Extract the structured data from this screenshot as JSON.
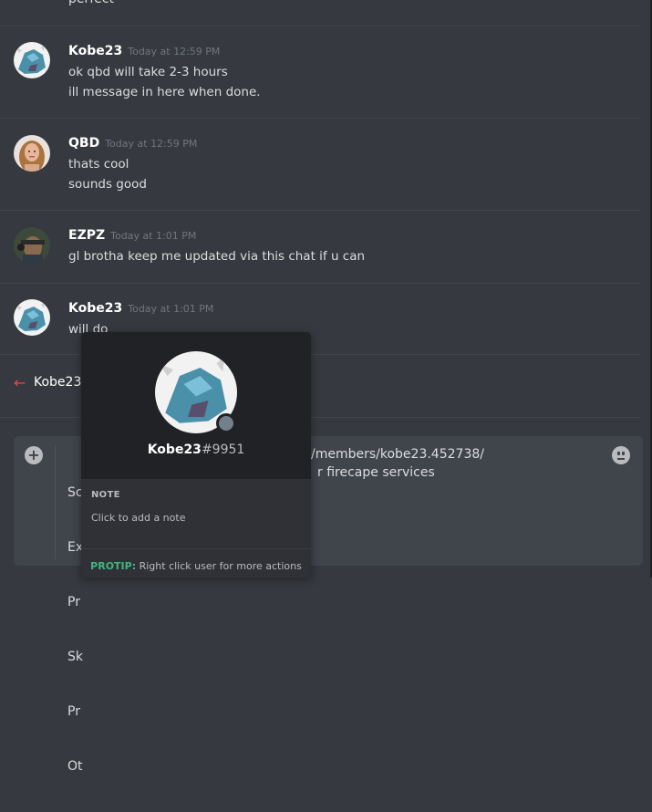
{
  "chat": {
    "top_fragment": "perfect",
    "messages": [
      {
        "author": "Kobe23",
        "timestamp": "Today at 12:59 PM",
        "lines": [
          "ok qbd will take 2-3 hours",
          "ill message in here when done."
        ]
      },
      {
        "author": "QBD",
        "timestamp": "Today at 12:59 PM",
        "lines": [
          "thats cool",
          "sounds good"
        ]
      },
      {
        "author": "EZPZ",
        "timestamp": "Today at 1:01 PM",
        "lines": [
          "gl brotha keep me updated via this chat if u can"
        ]
      },
      {
        "author": "Kobe23",
        "timestamp": "Today at 1:01 PM",
        "lines": [
          "will do"
        ]
      }
    ],
    "system_message": {
      "icon": "arrow-left-icon",
      "text": "Kobe23"
    }
  },
  "input": {
    "lines": [
      "Sc",
      "Ex",
      "Pr",
      "Sk",
      "Pr",
      "Ot"
    ],
    "partial_line_1": "/members/kobe23.452738/",
    "partial_line_2": "r firecape services"
  },
  "popout": {
    "username": "Kobe23",
    "discriminator": "#9951",
    "note_label": "NOTE",
    "note_placeholder": "Click to add a note",
    "protip_label": "PROTIP:",
    "protip_text": "Right click user for more actions"
  },
  "colors": {
    "background": "#36393f",
    "popout_header": "#202225",
    "protip": "#43b581",
    "arrow": "#f04747"
  }
}
